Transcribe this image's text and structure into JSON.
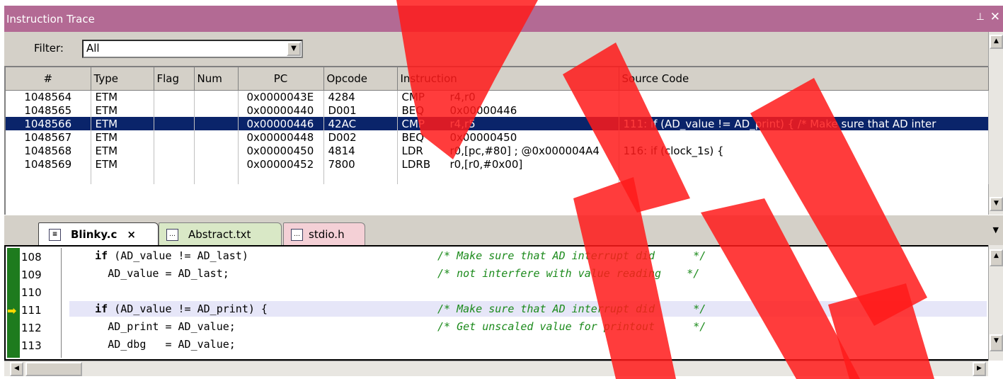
{
  "window": {
    "title": "Instruction Trace",
    "pin_icon": "pin-icon",
    "close_icon": "close-icon"
  },
  "filter": {
    "label": "Filter:",
    "value": "All"
  },
  "trace": {
    "columns": [
      "#",
      "Type",
      "Flag",
      "Num",
      "PC",
      "Opcode",
      "Instruction",
      "Source Code"
    ],
    "rows": [
      {
        "num": "1048564",
        "type": "ETM",
        "flag": "",
        "n": "",
        "pc": "0x0000043E",
        "opcode": "4284",
        "mn": "CMP",
        "ops": "r4,r0",
        "src": ""
      },
      {
        "num": "1048565",
        "type": "ETM",
        "flag": "",
        "n": "",
        "pc": "0x00000440",
        "opcode": "D001",
        "mn": "BEQ",
        "ops": "0x00000446",
        "src": ""
      },
      {
        "num": "1048566",
        "type": "ETM",
        "flag": "",
        "n": "",
        "pc": "0x00000446",
        "opcode": "42AC",
        "mn": "CMP",
        "ops": "r4,r5",
        "src": "111:     if (AD_value != AD_print) {          /* Make sure that AD inter"
      },
      {
        "num": "1048567",
        "type": "ETM",
        "flag": "",
        "n": "",
        "pc": "0x00000448",
        "opcode": "D002",
        "mn": "BEQ",
        "ops": "0x00000450",
        "src": ""
      },
      {
        "num": "1048568",
        "type": "ETM",
        "flag": "",
        "n": "",
        "pc": "0x00000450",
        "opcode": "4814",
        "mn": "LDR",
        "ops": "r0,[pc,#80]  ; @0x000004A4",
        "src": "116:     if (clock_1s) {"
      },
      {
        "num": "1048569",
        "type": "ETM",
        "flag": "",
        "n": "",
        "pc": "0x00000452",
        "opcode": "7800",
        "mn": "LDRB",
        "ops": "r0,[r0,#0x00]",
        "src": ""
      }
    ],
    "selected_index": 2
  },
  "tabs": [
    {
      "label": "Blinky.c",
      "active": true,
      "close": "×"
    },
    {
      "label": "Abstract.txt",
      "active": false
    },
    {
      "label": "stdio.h",
      "active": false
    }
  ],
  "editor": {
    "lines": [
      {
        "n": "108",
        "code": "    if (AD_value != AD_last)",
        "kw": "if",
        "rest": " (AD_value != AD_last)",
        "indent": "    ",
        "comment": "/* Make sure that AD interrupt did      */"
      },
      {
        "n": "109",
        "code": "      AD_value = AD_last;",
        "kw": "",
        "rest": "AD_value = AD_last;",
        "indent": "      ",
        "comment": "/* not interfere with value reading    */"
      },
      {
        "n": "110",
        "code": "",
        "kw": "",
        "rest": "",
        "indent": "",
        "comment": ""
      },
      {
        "n": "111",
        "code": "    if (AD_value != AD_print) {",
        "kw": "if",
        "rest": " (AD_value != AD_print) {",
        "indent": "    ",
        "comment": "/* Make sure that AD interrupt did      */"
      },
      {
        "n": "112",
        "code": "      AD_print = AD_value;",
        "kw": "",
        "rest": "AD_print = AD_value;",
        "indent": "      ",
        "comment": "/* Get unscaled value for printout      */"
      },
      {
        "n": "113",
        "code": "      AD_dbg   = AD_value;",
        "kw": "",
        "rest": "AD_dbg   = AD_value;",
        "indent": "      ",
        "comment": ""
      }
    ],
    "current_line": "111"
  },
  "colors": {
    "title_bg": "#b36a94",
    "selection": "#0a246a",
    "gutter": "#1e7b1e",
    "comment": "#1b8a1b",
    "watermark": "#ff0000"
  }
}
